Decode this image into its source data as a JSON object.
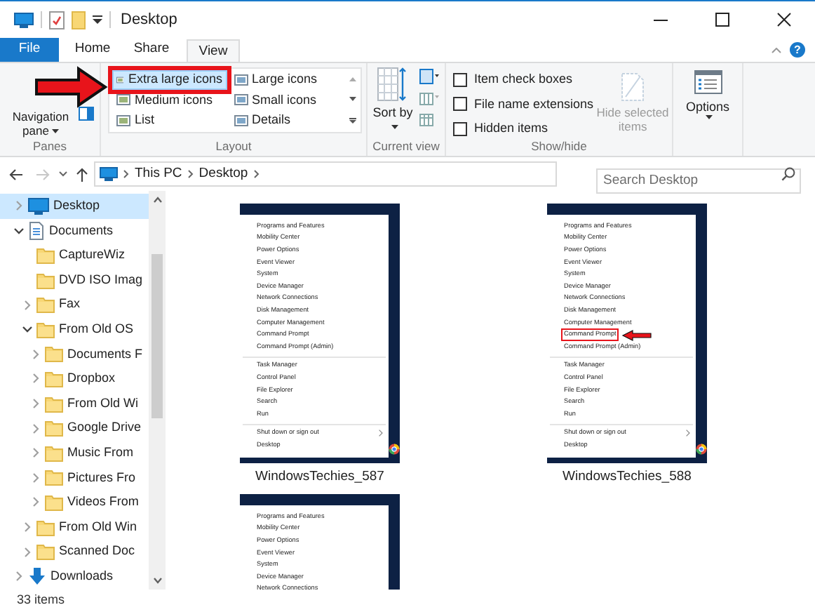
{
  "window": {
    "title": "Desktop"
  },
  "ribbon_tabs": [
    {
      "label": "File",
      "kind": "file",
      "selected": false
    },
    {
      "label": "Home",
      "kind": "tab",
      "selected": false
    },
    {
      "label": "Share",
      "kind": "tab",
      "selected": false
    },
    {
      "label": "View",
      "kind": "tab",
      "selected": true
    }
  ],
  "help": "?",
  "ribbon": {
    "panes": {
      "label": "Panes",
      "navigation_pane": "Navigation pane"
    },
    "layout": {
      "label": "Layout",
      "options": [
        {
          "label": "Extra large icons",
          "selected": true,
          "annotated": true
        },
        {
          "label": "Large icons",
          "selected": false,
          "annotated": false
        },
        {
          "label": "Medium icons",
          "selected": false,
          "annotated": false
        },
        {
          "label": "Small icons",
          "selected": false,
          "annotated": false
        },
        {
          "label": "List",
          "selected": false,
          "annotated": false
        },
        {
          "label": "Details",
          "selected": false,
          "annotated": false
        }
      ]
    },
    "current_view": {
      "label": "Current view",
      "sort_by": "Sort by"
    },
    "show_hide": {
      "label": "Show/hide",
      "checkboxes": [
        {
          "label": "Item check boxes",
          "checked": false
        },
        {
          "label": "File name extensions",
          "checked": false
        },
        {
          "label": "Hidden items",
          "checked": false
        }
      ],
      "hide_selected": {
        "label": "Hide selected items",
        "disabled": true
      }
    },
    "options": {
      "label": "Options"
    }
  },
  "address_bar": {
    "path": [
      "This PC",
      "Desktop"
    ]
  },
  "search": {
    "placeholder": "Search Desktop"
  },
  "nav_tree": [
    {
      "label": "Desktop",
      "kind": "desktop",
      "expandable": true,
      "expanded": false,
      "selected": true
    },
    {
      "label": "Documents",
      "kind": "documents",
      "expandable": true,
      "expanded": true,
      "selected": false,
      "children": [
        {
          "label": "CaptureWiz",
          "kind": "folder",
          "expandable": false,
          "selected": false
        },
        {
          "label": "DVD ISO Imag",
          "kind": "folder",
          "expandable": false,
          "selected": false
        },
        {
          "label": "Fax",
          "kind": "folder",
          "expandable": true,
          "expanded": false,
          "selected": false
        },
        {
          "label": "From Old OS",
          "kind": "folder",
          "expandable": true,
          "expanded": true,
          "selected": false,
          "children": [
            {
              "label": "Documents F",
              "kind": "folder",
              "expandable": true,
              "expanded": false,
              "selected": false
            },
            {
              "label": "Dropbox",
              "kind": "folder",
              "expandable": true,
              "expanded": false,
              "selected": false
            },
            {
              "label": "From Old Wi",
              "kind": "folder",
              "expandable": true,
              "expanded": false,
              "selected": false
            },
            {
              "label": "Google Drive",
              "kind": "folder",
              "expandable": true,
              "expanded": false,
              "selected": false
            },
            {
              "label": "Music From",
              "kind": "folder",
              "expandable": true,
              "expanded": false,
              "selected": false
            },
            {
              "label": "Pictures Fro",
              "kind": "folder",
              "expandable": true,
              "expanded": false,
              "selected": false
            },
            {
              "label": "Videos From",
              "kind": "folder",
              "expandable": true,
              "expanded": false,
              "selected": false
            }
          ]
        },
        {
          "label": "From Old Win",
          "kind": "folder",
          "expandable": true,
          "expanded": false,
          "selected": false
        },
        {
          "label": "Scanned Doc",
          "kind": "folder",
          "expandable": true,
          "expanded": false,
          "selected": false
        }
      ]
    },
    {
      "label": "Downloads",
      "kind": "downloads",
      "expandable": true,
      "expanded": false,
      "selected": false
    }
  ],
  "thumbnails": [
    {
      "caption": "WindowsTechies_587",
      "menu": [
        [
          {
            "label": "Programs and Features",
            "highlighted": false,
            "submenu": false
          },
          {
            "label": "Mobility Center",
            "highlighted": false,
            "submenu": false
          },
          {
            "label": "Power Options",
            "highlighted": false,
            "submenu": false
          },
          {
            "label": "Event Viewer",
            "highlighted": false,
            "submenu": false
          },
          {
            "label": "System",
            "highlighted": false,
            "submenu": false
          },
          {
            "label": "Device Manager",
            "highlighted": false,
            "submenu": false
          },
          {
            "label": "Network Connections",
            "highlighted": false,
            "submenu": false
          },
          {
            "label": "Disk Management",
            "highlighted": false,
            "submenu": false
          },
          {
            "label": "Computer Management",
            "highlighted": false,
            "submenu": false
          },
          {
            "label": "Command Prompt",
            "highlighted": false,
            "submenu": false
          },
          {
            "label": "Command Prompt (Admin)",
            "highlighted": false,
            "submenu": false
          }
        ],
        [
          {
            "label": "Task Manager",
            "highlighted": false,
            "submenu": false
          },
          {
            "label": "Control Panel",
            "highlighted": false,
            "submenu": false
          },
          {
            "label": "File Explorer",
            "highlighted": false,
            "submenu": false
          },
          {
            "label": "Search",
            "highlighted": false,
            "submenu": false
          },
          {
            "label": "Run",
            "highlighted": false,
            "submenu": false
          }
        ],
        [
          {
            "label": "Shut down or sign out",
            "highlighted": false,
            "submenu": true
          },
          {
            "label": "Desktop",
            "highlighted": false,
            "submenu": false
          }
        ]
      ]
    },
    {
      "caption": "WindowsTechies_588",
      "menu": [
        [
          {
            "label": "Programs and Features",
            "highlighted": false,
            "submenu": false
          },
          {
            "label": "Mobility Center",
            "highlighted": false,
            "submenu": false
          },
          {
            "label": "Power Options",
            "highlighted": false,
            "submenu": false
          },
          {
            "label": "Event Viewer",
            "highlighted": false,
            "submenu": false
          },
          {
            "label": "System",
            "highlighted": false,
            "submenu": false
          },
          {
            "label": "Device Manager",
            "highlighted": false,
            "submenu": false
          },
          {
            "label": "Network Connections",
            "highlighted": false,
            "submenu": false
          },
          {
            "label": "Disk Management",
            "highlighted": false,
            "submenu": false
          },
          {
            "label": "Computer Management",
            "highlighted": false,
            "submenu": false
          },
          {
            "label": "Command Prompt",
            "highlighted": true,
            "submenu": false
          },
          {
            "label": "Command Prompt (Admin)",
            "highlighted": false,
            "submenu": false
          }
        ],
        [
          {
            "label": "Task Manager",
            "highlighted": false,
            "submenu": false
          },
          {
            "label": "Control Panel",
            "highlighted": false,
            "submenu": false
          },
          {
            "label": "File Explorer",
            "highlighted": false,
            "submenu": false
          },
          {
            "label": "Search",
            "highlighted": false,
            "submenu": false
          },
          {
            "label": "Run",
            "highlighted": false,
            "submenu": false
          }
        ],
        [
          {
            "label": "Shut down or sign out",
            "highlighted": false,
            "submenu": true
          },
          {
            "label": "Desktop",
            "highlighted": false,
            "submenu": false
          }
        ]
      ]
    },
    {
      "menu": [
        [
          {
            "label": "Programs and Features",
            "highlighted": false,
            "submenu": false
          },
          {
            "label": "Mobility Center",
            "highlighted": false,
            "submenu": false
          },
          {
            "label": "Power Options",
            "highlighted": false,
            "submenu": false
          },
          {
            "label": "Event Viewer",
            "highlighted": false,
            "submenu": false
          },
          {
            "label": "System",
            "highlighted": false,
            "submenu": false
          },
          {
            "label": "Device Manager",
            "highlighted": false,
            "submenu": false
          },
          {
            "label": "Network Connections",
            "highlighted": false,
            "submenu": false
          }
        ]
      ]
    }
  ],
  "status_bar": {
    "item_count": "33 items"
  }
}
